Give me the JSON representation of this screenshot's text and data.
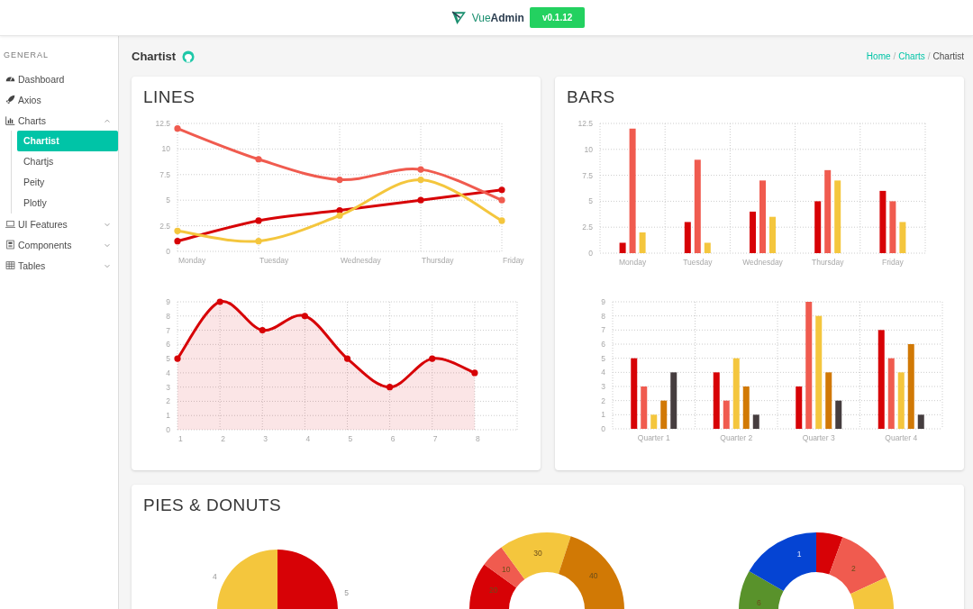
{
  "header": {
    "brand_first": "Vue",
    "brand_second": "Admin",
    "version": "v0.1.12"
  },
  "sidebar": {
    "section": "GENERAL",
    "items": [
      {
        "label": "Dashboard"
      },
      {
        "label": "Axios"
      },
      {
        "label": "Charts",
        "expanded": true,
        "children": [
          {
            "label": "Chartist",
            "selected": true
          },
          {
            "label": "Chartjs",
            "selected": false
          },
          {
            "label": "Peity",
            "selected": false
          },
          {
            "label": "Plotly",
            "selected": false
          }
        ]
      },
      {
        "label": "UI Features",
        "expanded": false
      },
      {
        "label": "Components",
        "expanded": false
      },
      {
        "label": "Tables",
        "expanded": false
      }
    ]
  },
  "page_title": "Chartist",
  "breadcrumb": [
    {
      "kind": "link",
      "text": "Home"
    },
    {
      "kind": "separator",
      "text": "/"
    },
    {
      "kind": "link",
      "text": "Charts"
    },
    {
      "kind": "separator",
      "text": "/"
    },
    {
      "kind": "current",
      "text": "Chartist"
    }
  ],
  "cards": [
    {
      "title": "LINES",
      "charts": [
        {
          "chart_data": {
            "type": "line",
            "grid": true,
            "categories": [
              "Monday",
              "Tuesday",
              "Wednesday",
              "Thursday",
              "Friday"
            ],
            "ylim": [
              0,
              12.5
            ],
            "yticks": [
              0,
              2.5,
              5,
              7.5,
              10,
              12.5
            ],
            "series": [
              {
                "color": "#d70206",
                "marker": true,
                "values": [
                  1,
                  3,
                  4,
                  5,
                  6
                ]
              },
              {
                "color": "#f05b4f",
                "marker": true,
                "values": [
                  12,
                  9,
                  7,
                  8,
                  5
                ]
              },
              {
                "color": "#f4c63d",
                "marker": true,
                "values": [
                  2,
                  1,
                  3.5,
                  7,
                  3
                ]
              }
            ]
          }
        },
        {
          "chart_data": {
            "type": "area",
            "grid": true,
            "categories": [
              "1",
              "2",
              "3",
              "4",
              "5",
              "6",
              "7",
              "8"
            ],
            "ylim": [
              0,
              9
            ],
            "yticks": [
              0,
              1,
              2,
              3,
              4,
              5,
              6,
              7,
              8,
              9
            ],
            "series": [
              {
                "color": "#d70206",
                "marker": true,
                "values": [
                  5,
                  9,
                  7,
                  8,
                  5,
                  3,
                  5,
                  4
                ]
              }
            ]
          }
        }
      ]
    },
    {
      "title": "BARS",
      "charts": [
        {
          "chart_data": {
            "type": "bar",
            "grid": true,
            "categories": [
              "Monday",
              "Tuesday",
              "Wednesday",
              "Thursday",
              "Friday"
            ],
            "ylim": [
              0,
              12.5
            ],
            "yticks": [
              0,
              2.5,
              5,
              7.5,
              10,
              12.5
            ],
            "series": [
              {
                "color": "#d70206",
                "values": [
                  1,
                  3,
                  4,
                  5,
                  6
                ]
              },
              {
                "color": "#f05b4f",
                "values": [
                  12,
                  9,
                  7,
                  8,
                  5
                ]
              },
              {
                "color": "#f4c63d",
                "values": [
                  2,
                  1,
                  3.5,
                  7,
                  3
                ]
              }
            ]
          }
        },
        {
          "chart_data": {
            "type": "bar",
            "grid": true,
            "categories": [
              "Quarter 1",
              "Quarter 2",
              "Quarter 3",
              "Quarter 4"
            ],
            "ylim": [
              0,
              9
            ],
            "yticks": [
              0,
              1,
              2,
              3,
              4,
              5,
              6,
              7,
              8,
              9
            ],
            "series": [
              {
                "color": "#d70206",
                "values": [
                  5,
                  4,
                  3,
                  7
                ]
              },
              {
                "color": "#f05b4f",
                "values": [
                  3,
                  2,
                  9,
                  5
                ]
              },
              {
                "color": "#f4c63d",
                "values": [
                  1,
                  5,
                  8,
                  4
                ]
              },
              {
                "color": "#d17905",
                "values": [
                  2,
                  3,
                  4,
                  6
                ]
              },
              {
                "color": "#453d3f",
                "values": [
                  4,
                  1,
                  2,
                  1
                ]
              }
            ]
          }
        }
      ]
    },
    {
      "title": "PIES & DONUTS",
      "pies": [
        {
          "kind": "pie",
          "labels": [
            "5",
            "4"
          ]
        },
        {
          "kind": "donut",
          "labels": [
            "20",
            "10",
            "30",
            "40"
          ]
        },
        {
          "kind": "ring",
          "labels": [
            "2",
            "6",
            "1"
          ]
        }
      ]
    }
  ]
}
